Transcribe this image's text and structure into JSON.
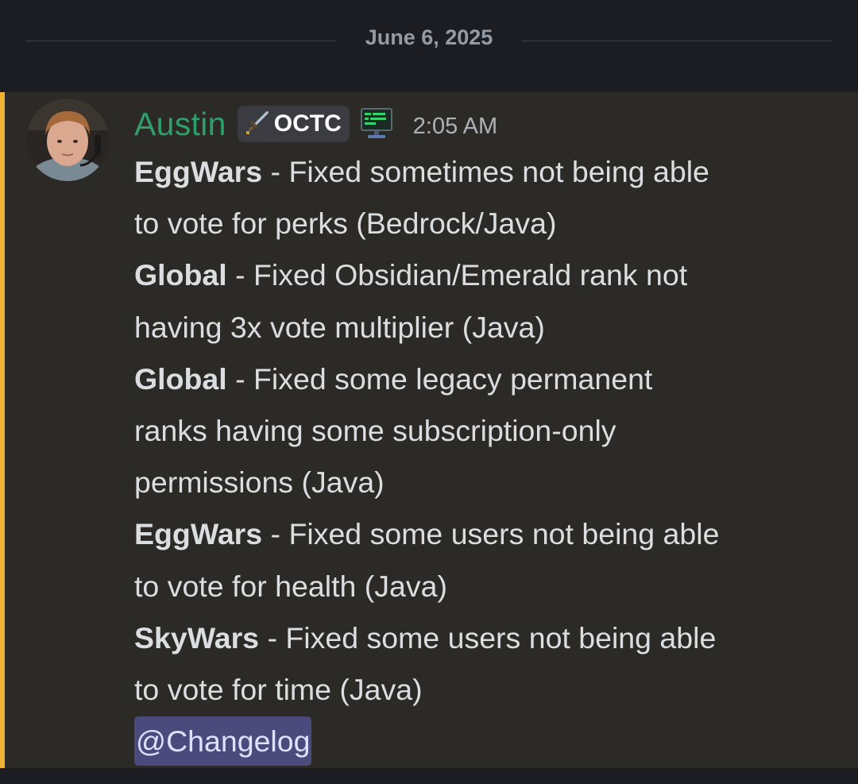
{
  "date_divider": {
    "date": "June 6, 2025"
  },
  "message": {
    "author": "Austin",
    "tag": "OCTC",
    "timestamp": "2:05 AM",
    "lines": [
      {
        "bold": "EggWars",
        "text": " - Fixed sometimes not being able"
      },
      {
        "bold": "",
        "text": "to vote for perks (Bedrock/Java)"
      },
      {
        "bold": "Global",
        "text": " - Fixed Obsidian/Emerald rank not"
      },
      {
        "bold": "",
        "text": "having 3x vote multiplier (Java)"
      },
      {
        "bold": "Global",
        "text": " - Fixed some legacy permanent"
      },
      {
        "bold": "",
        "text": "ranks having some subscription-only"
      },
      {
        "bold": "",
        "text": "permissions (Java)"
      },
      {
        "bold": "EggWars",
        "text": " - Fixed some users not being able"
      },
      {
        "bold": "",
        "text": "to vote for health (Java)"
      },
      {
        "bold": "SkyWars",
        "text": " - Fixed some users not being able"
      },
      {
        "bold": "",
        "text": "to vote for time (Java)"
      }
    ],
    "mention": "@Changelog"
  },
  "colors": {
    "author": "#2e9e6a",
    "highlight_bar": "#f0b232",
    "mention_bg": "#4b4a7c"
  },
  "icons": {
    "tag_icon": "sword-icon",
    "app_icon": "terminal-monitor-icon"
  }
}
